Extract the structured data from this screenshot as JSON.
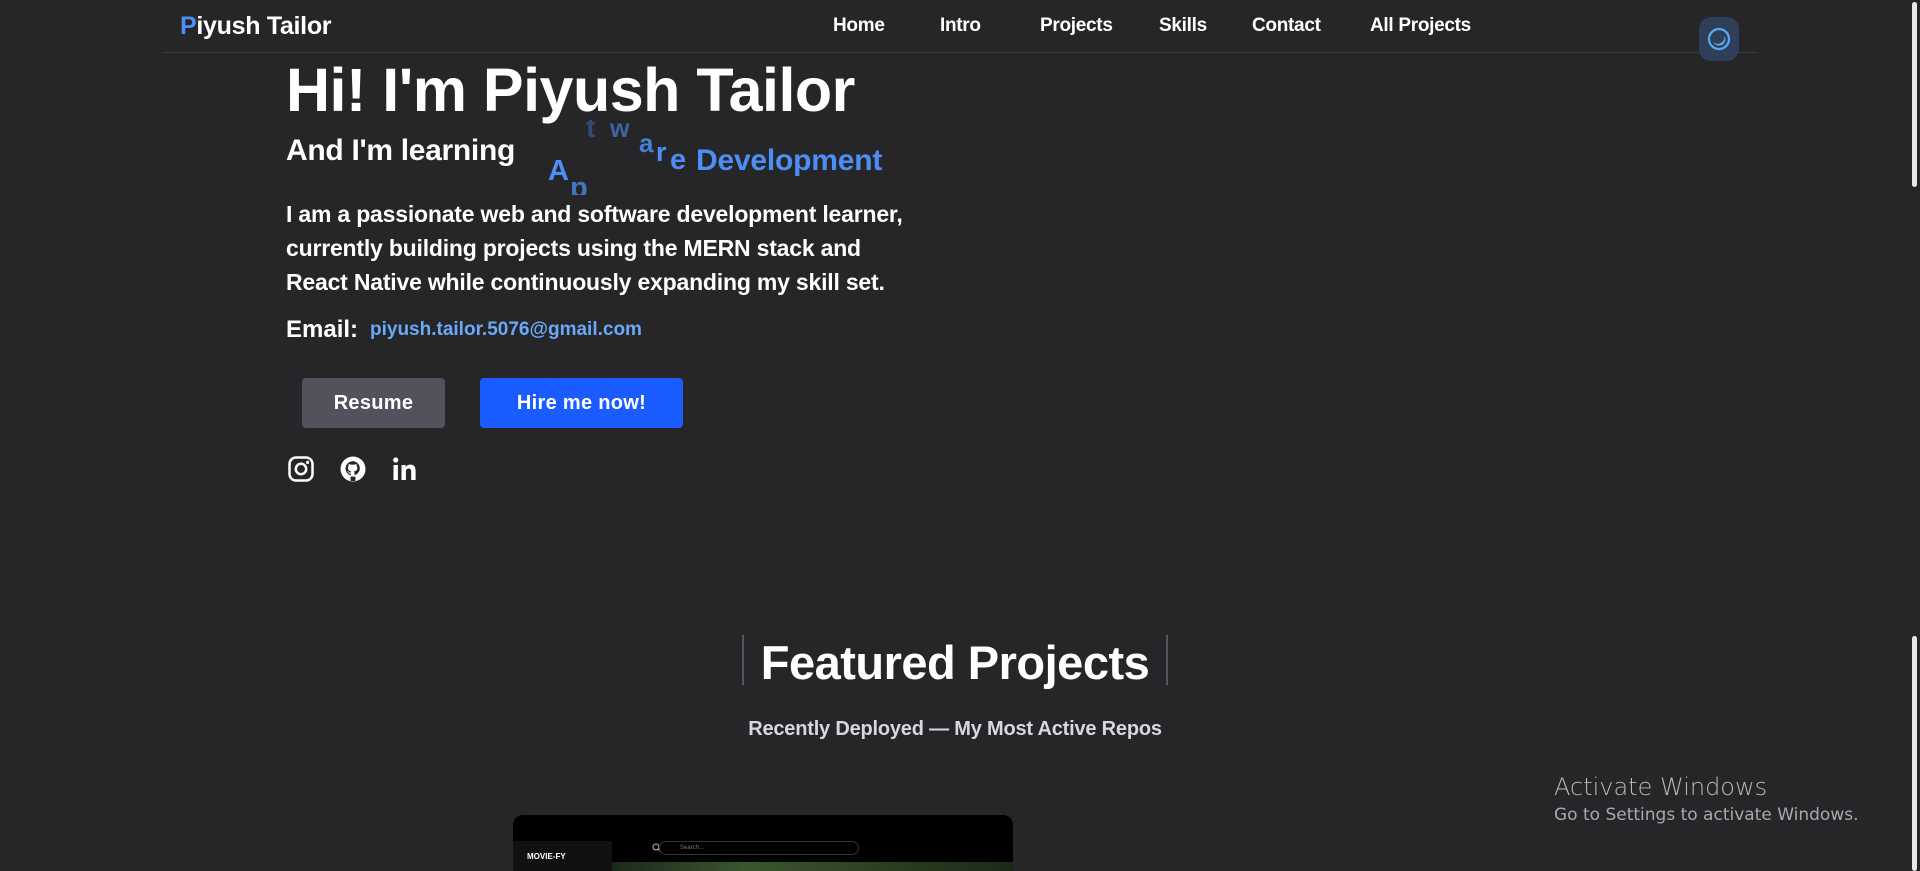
{
  "navbar": {
    "logo_first": "P",
    "logo_rest": "iyush Tailor",
    "links": [
      "Home",
      "Intro",
      "Projects",
      "Skills",
      "Contact",
      "All Projects"
    ],
    "theme_icon": "theme-toggle-icon"
  },
  "hero": {
    "title": "Hi! I'm Piyush Tailor",
    "subtitle": "And I'm learning",
    "animated_letters": [
      "A",
      "p",
      "t",
      "w",
      "a",
      "r",
      "e"
    ],
    "animated_word": "Development",
    "description": "I am a passionate web and software development learner, currently building projects using the MERN stack and React Native while continuously expanding my skill set.",
    "email_label": "Email:",
    "email": "piyush.tailor.5076@gmail.com",
    "resume_label": "Resume",
    "hire_label": "Hire me now!",
    "socials": [
      "instagram-icon",
      "github-icon",
      "linkedin-icon"
    ]
  },
  "featured": {
    "title": "Featured Projects",
    "subtitle": "Recently Deployed — My Most Active Repos",
    "card": {
      "logo": "MOVIE-FY",
      "search_placeholder": "Search..."
    }
  },
  "watermark": {
    "title": "Activate Windows",
    "subtitle": "Go to Settings to activate Windows."
  },
  "colors": {
    "background": "#262628",
    "accent": "#4d8ef5",
    "hire_button": "#1a5cff",
    "resume_button": "#52525d"
  }
}
